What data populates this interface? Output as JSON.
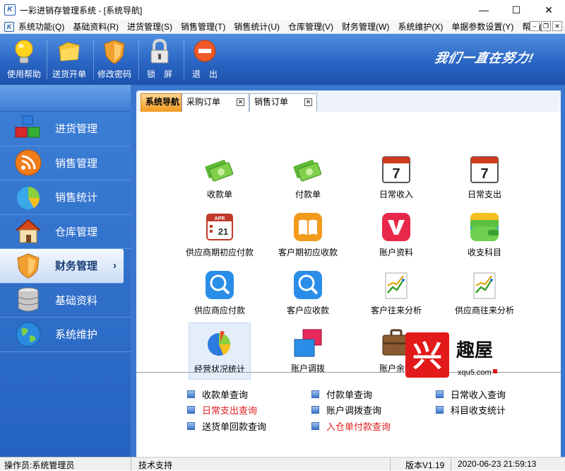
{
  "window": {
    "title": "一彩进销存管理系统 - [系统导航]",
    "minimize": "—",
    "maximize": "☐",
    "close": "✕"
  },
  "menu": [
    "系统功能(Q)",
    "基础资料(R)",
    "进货管理(S)",
    "销售管理(T)",
    "销售统计(U)",
    "仓库管理(V)",
    "财务管理(W)",
    "系统维护(X)",
    "单据参数设置(Y)",
    "帮助(Z)"
  ],
  "toolbar": {
    "items": [
      "使用帮助",
      "送货开单",
      "修改密码",
      "锁　屏",
      "退　出"
    ],
    "slogan": "我们一直在努力!"
  },
  "sidebar": {
    "items": [
      "进货管理",
      "销售管理",
      "销售统计",
      "仓库管理",
      "财务管理",
      "基础资料",
      "系统维护"
    ],
    "active_index": 4,
    "arrow": "›"
  },
  "tabs": [
    "系统导航",
    "采购订单",
    "销售订单"
  ],
  "grid": [
    "收款单",
    "付款单",
    "日常收入",
    "日常支出",
    "供应商期初应付款",
    "客户期初应收款",
    "账户资料",
    "收支科目",
    "供应商应付款",
    "客户应收款",
    "客户往来分析",
    "供应商往来分析",
    "经营状况统计",
    "账户调拨",
    "账户余额"
  ],
  "calendar_day": "7",
  "calendar_month": "APR",
  "calendar_num": "21",
  "links": [
    {
      "label": "收款单查询",
      "red": false
    },
    {
      "label": "付款单查询",
      "red": false
    },
    {
      "label": "日常收入查询",
      "red": false
    },
    {
      "label": "日常支出查询",
      "red": true
    },
    {
      "label": "账户调拨查询",
      "red": false
    },
    {
      "label": "科目收支统计",
      "red": false
    },
    {
      "label": "送货单回款查询",
      "red": false
    },
    {
      "label": "入仓单付款查询",
      "red": true
    }
  ],
  "statusbar": {
    "operator": "操作员:系统管理员",
    "support": "技术支持",
    "version": "版本V1.19",
    "datetime": "2020-06-23 21:59:13"
  },
  "watermark": {
    "mark": "兴",
    "brand": "趣屋",
    "domain": "xqu5.com"
  },
  "colors": {
    "accent": "#2a66c4",
    "red_link": "#e02020",
    "tab_selected": "#f39a1e"
  }
}
